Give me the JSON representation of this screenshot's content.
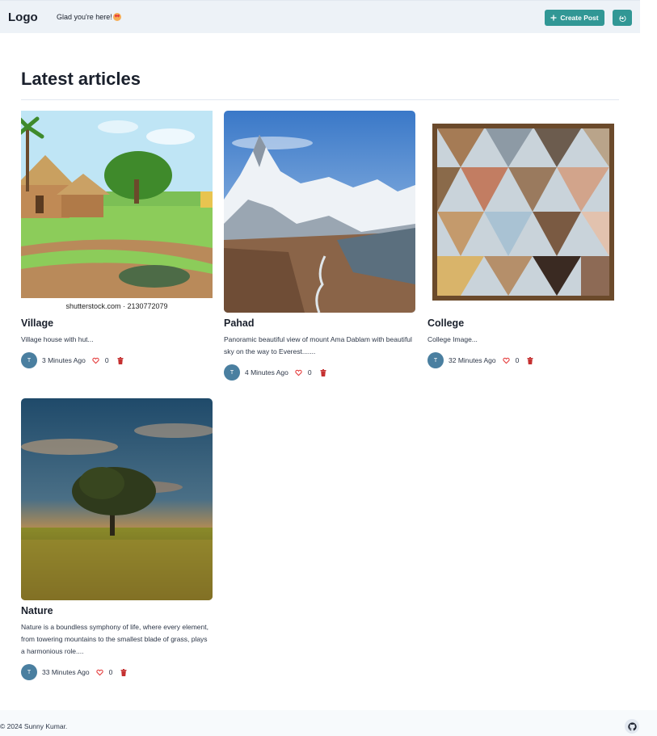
{
  "header": {
    "logo": "Logo",
    "greeting": "Glad you're here!",
    "create_label": "Create Post"
  },
  "main": {
    "title": "Latest articles"
  },
  "articles": [
    {
      "title": "Village",
      "description": "Village house with hut...",
      "image_caption": "shutterstock.com · 2130772079",
      "author_initial": "T",
      "time": "3 Minutes Ago",
      "likes": "0"
    },
    {
      "title": "Pahad",
      "description": "Panoramic beautiful view of mount Ama Dablam with beautiful sky on the way to Everest.......",
      "author_initial": "T",
      "time": "4 Minutes Ago",
      "likes": "0"
    },
    {
      "title": "College",
      "description": "College Image...",
      "author_initial": "T",
      "time": "32 Minutes Ago",
      "likes": "0"
    },
    {
      "title": "Nature",
      "description": "Nature is a boundless symphony of life, where every element, from towering mountains to the smallest blade of grass, plays a harmonious role....",
      "author_initial": "T",
      "time": "33 Minutes Ago",
      "likes": "0"
    }
  ],
  "footer": {
    "copyright": "© 2024 Sunny Kumar."
  },
  "colors": {
    "accent": "#319795",
    "header_bg": "#edf2f7",
    "like_red": "#e53e3e",
    "avatar": "#4a7fa0"
  },
  "icons": [
    "moon-icon",
    "plus-icon",
    "logout-icon",
    "heart-icon",
    "trash-icon",
    "github-icon"
  ]
}
